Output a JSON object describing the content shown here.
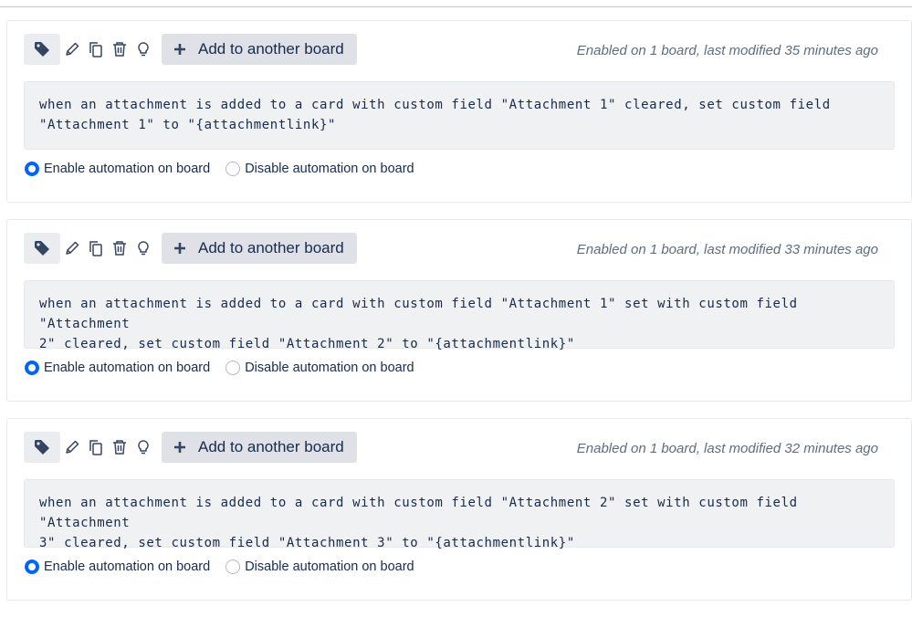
{
  "colors": {
    "accent": "#0065ff",
    "button_bg": "#dfe1e6",
    "rule_bg": "#f0f1f3",
    "muted_text": "#5e6c84",
    "text": "#172b4d"
  },
  "icons": [
    "tag-icon",
    "pencil-icon",
    "copy-icon",
    "trash-icon",
    "lightbulb-icon",
    "plus-icon"
  ],
  "cards": [
    {
      "add_label": "Add to another board",
      "status": "Enabled on 1 board, last modified 35 minutes ago",
      "rule_line1": "when an attachment is added to a card with custom field \"Attachment 1\" cleared, set custom field",
      "rule_line2": "\"Attachment 1\" to \"{attachmentlink}\"",
      "enable_label": "Enable automation on board",
      "disable_label": "Disable automation on board",
      "selected": "enable"
    },
    {
      "add_label": "Add to another board",
      "status": "Enabled on 1 board, last modified 33 minutes ago",
      "rule_line1": "when an attachment is added to a card with custom field \"Attachment 1\" set with custom field \"Attachment",
      "rule_line2": "2\" cleared, set custom field \"Attachment 2\" to \"{attachmentlink}\"",
      "enable_label": "Enable automation on board",
      "disable_label": "Disable automation on board",
      "selected": "enable"
    },
    {
      "add_label": "Add to another board",
      "status": "Enabled on 1 board, last modified 32 minutes ago",
      "rule_line1": "when an attachment is added to a card with custom field \"Attachment 2\" set with custom field \"Attachment",
      "rule_line2": "3\" cleared, set custom field \"Attachment 3\" to \"{attachmentlink}\"",
      "enable_label": "Enable automation on board",
      "disable_label": "Disable automation on board",
      "selected": "enable"
    }
  ]
}
